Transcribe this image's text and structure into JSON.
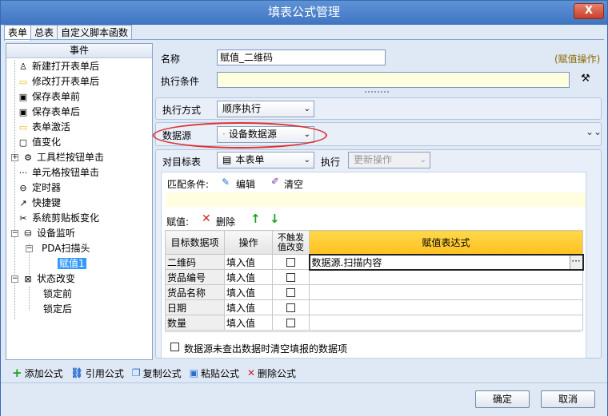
{
  "window": {
    "title": "填表公式管理",
    "close": "X"
  },
  "tabs": [
    "表单",
    "总表",
    "自定义脚本函数"
  ],
  "tree": {
    "header": "事件",
    "items": [
      "新建打开表单后",
      "修改打开表单后",
      "保存表单前",
      "保存表单后",
      "表单激活",
      "值变化",
      "工具栏按钮单击",
      "单元格按钮单击",
      "定时器",
      "快捷键",
      "系统剪贴板变化",
      "设备监听",
      "PDA扫描头",
      "赋值1",
      "状态改变",
      "锁定前",
      "锁定后"
    ]
  },
  "form": {
    "name_label": "名称",
    "name_value": "赋值_二维码",
    "op_link": "(赋值操作)",
    "condition_label": "执行条件",
    "exec_mode_label": "执行方式",
    "exec_mode_value": "顺序执行",
    "datasource_label": "数据源",
    "datasource_value": "设备数据源",
    "target_label": "对目标表",
    "target_value": "本表单",
    "exec_label": "执行",
    "exec_value": "更新操作",
    "match_label": "匹配条件:",
    "edit_label": "编辑",
    "clear_label": "清空",
    "assign_label": "赋值:",
    "delete_label": "删除",
    "clear_check_label": "数据源未查出数据时清空填报的数据项"
  },
  "grid": {
    "headers": [
      "目标数据项",
      "操作",
      "不触发值改变",
      "赋值表达式"
    ],
    "rows": [
      {
        "item": "二维码",
        "op": "填入值",
        "expr": "数据源.扫描内容"
      },
      {
        "item": "货品编号",
        "op": "填入值",
        "expr": ""
      },
      {
        "item": "货品名称",
        "op": "填入值",
        "expr": ""
      },
      {
        "item": "日期",
        "op": "填入值",
        "expr": ""
      },
      {
        "item": "数量",
        "op": "填入值",
        "expr": ""
      }
    ],
    "ellipsis": "···"
  },
  "toolbar": {
    "add": "添加公式",
    "ref": "引用公式",
    "copy": "复制公式",
    "paste": "粘贴公式",
    "del": "删除公式"
  },
  "buttons": {
    "ok": "确定",
    "cancel": "取消"
  },
  "colors": {
    "accent": "#3f74c2",
    "selection": "#3399ff",
    "close": "#c7412a",
    "highlight": "#e03030"
  }
}
